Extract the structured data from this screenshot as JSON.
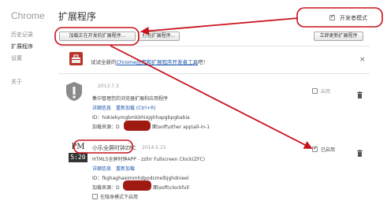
{
  "sidebar": {
    "logo": "Chrome",
    "items": [
      {
        "label": "历史记录"
      },
      {
        "label": "扩展程序"
      },
      {
        "label": "设置"
      },
      {
        "label": "关于"
      }
    ]
  },
  "header": {
    "title": "扩展程序",
    "dev_mode_label": "开发者模式",
    "dev_mode_checked": true
  },
  "toolbar": {
    "load_unpacked": "加载正在开发的扩展程序...",
    "pack_extension": "打包扩展程序...",
    "update_now": "立即更新扩展程序"
  },
  "promo": {
    "prefix": "试试全新的",
    "link": "Chrome应用和扩展程序开发者工具",
    "suffix": "吧！",
    "close": "×"
  },
  "extensions": [
    {
      "version": "2013.7.3",
      "description": "集中管理您的浏览器扩展和应用程序",
      "details_link": "详细信息",
      "reload_link": "重新加载 (Ctrl+R)",
      "id_label": "ID：",
      "id_value": "hokiekymgbmkbhiojghhapgbpgbabia",
      "load_label": "加载来源：",
      "load_value_prefix": "D",
      "load_value_suffix": "面\\soft\\other app\\all-in-1",
      "enable_label": "启用",
      "enabled": false
    },
    {
      "name": "小乐全屏时钟ZFC",
      "version": "2014.5.15",
      "description": "HTML5全屏时钟APP - zzllrr Fullscreen Clock(ZFC)",
      "details_link": "详细信息",
      "reload_link": "重新加载",
      "id_label": "ID：",
      "id_value": "fkghaghaeimmhdpodcmelbjghdnieel",
      "load_label": "加载来源：",
      "load_value_prefix": "D",
      "load_value_suffix": "面\\soft\\clockfull",
      "incognito_label": "在隐身模式下启用",
      "enable_label": "已启用",
      "enabled": true,
      "icon_top": "PM",
      "icon_time": "5:20"
    }
  ]
}
